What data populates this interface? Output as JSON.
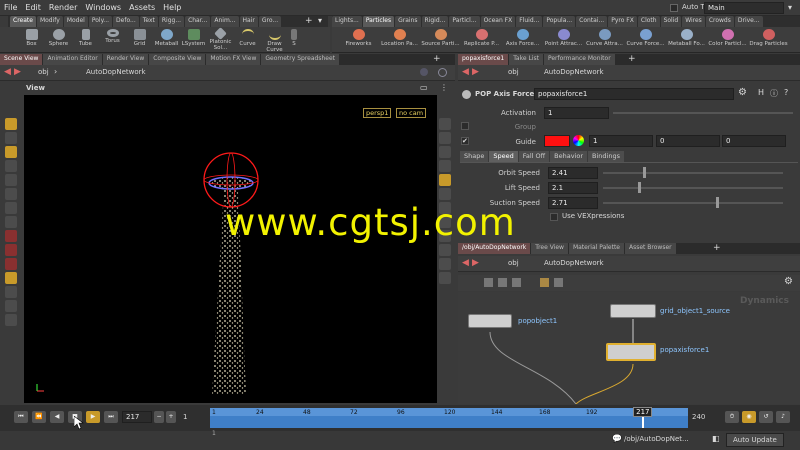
{
  "menu": [
    "File",
    "Edit",
    "Render",
    "Windows",
    "Assets",
    "Help"
  ],
  "auto_takes": "Auto Takes",
  "desktop": "Main",
  "shelf_tabs_left": [
    "Create",
    "Modify",
    "Model",
    "Poly...",
    "Defo...",
    "Text",
    "Rigg...",
    "Char...",
    "Anim...",
    "Hair",
    "Gro..."
  ],
  "shelf_tools_left": [
    "Box",
    "Sphere",
    "Tube",
    "Torus",
    "Grid",
    "Metaball",
    "LSystem",
    "Platonic Sol...",
    "Curve",
    "Draw Curve",
    "S"
  ],
  "shelf_tabs_right": [
    "Lights...",
    "Particles",
    "Grains",
    "Rigid...",
    "Particl...",
    "Ocean FX",
    "Fluid...",
    "Popula...",
    "Contai...",
    "Pyro FX",
    "Cloth",
    "Solid",
    "Wires",
    "Crowds",
    "Drive..."
  ],
  "shelf_tools_right": [
    "Fireworks",
    "Location Pa...",
    "Source Parti...",
    "Replicate P...",
    "Axis Force...",
    "Point Attrac...",
    "Curve Attra...",
    "Curve Force...",
    "Metaball Fo...",
    "Color Particl...",
    "Drag Particles"
  ],
  "left_tabs": [
    "Scene View",
    "Animation Editor",
    "Render View",
    "Composite View",
    "Motion FX View",
    "Geometry Spreadsheet"
  ],
  "left_path": {
    "root": "obj",
    "network": "AutoDopNetwork"
  },
  "viewport": {
    "title": "View",
    "camera": "persp1",
    "cam_menu": "no cam"
  },
  "right_top_tabs": [
    "popaxisforce1",
    "Take List",
    "Performance Monitor"
  ],
  "params": {
    "node_type": "POP Axis Force",
    "node_name": "popaxisforce1",
    "activation_label": "Activation",
    "activation": "1",
    "group_label": "Group",
    "guide_label": "Guide",
    "guide_color": "#ff1010",
    "guide_values": [
      "1",
      "0",
      "0"
    ],
    "tabs": [
      "Shape",
      "Speed",
      "Fall Off",
      "Behavior",
      "Bindings"
    ],
    "orbit_label": "Orbit Speed",
    "orbit": "2.41",
    "lift_label": "Lift Speed",
    "lift": "2.1",
    "suction_label": "Suction Speed",
    "suction": "2.71",
    "vex_label": "Use VEXpressions"
  },
  "right_bottom_tabs": [
    "/obj/AutoDopNetwork",
    "Tree View",
    "Material Palette",
    "Asset Browser"
  ],
  "network_path": {
    "root": "obj",
    "network": "AutoDopNetwork"
  },
  "network_context": "Dynamics",
  "nodes": {
    "a": "popobject1",
    "b": "grid_object1_source",
    "c": "popaxisforce1"
  },
  "watermark": "www.cgtsj.com",
  "timeline": {
    "frame": "217",
    "step": "1",
    "ticks": [
      "1",
      "24",
      "48",
      "72",
      "96",
      "120",
      "144",
      "168",
      "192"
    ],
    "current": "217",
    "end": "240",
    "range_start": "1",
    "range_end": "240",
    "current_fraction": 0.904
  },
  "status": {
    "path": "/obj/AutoDopNet...",
    "update": "Auto Update"
  }
}
